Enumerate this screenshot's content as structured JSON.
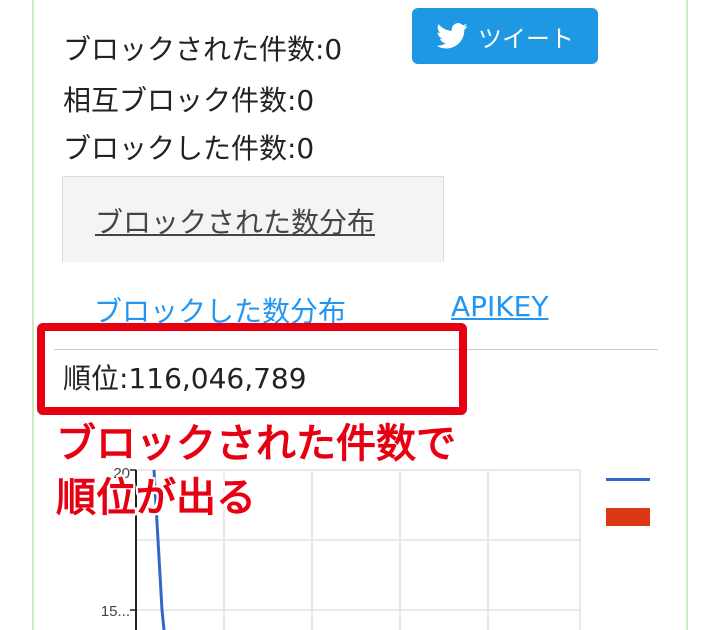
{
  "stats": {
    "blocked_count": "ブロックされた件数:0",
    "mutual_block_count": "相互ブロック件数:0",
    "blocking_count": "ブロックした件数:0"
  },
  "tweet_button": {
    "label": "ツイート",
    "icon": "twitter-bird-icon",
    "color": "#1f98e3"
  },
  "tabs": [
    {
      "label": "ブロックされた数分布",
      "active": true
    },
    {
      "label": "ブロックした数分布",
      "active": false
    },
    {
      "label": "APIKEY",
      "active": false
    }
  ],
  "rank": {
    "text": "順位:116,046,789"
  },
  "annotation": {
    "line1": "ブロックされた件数で",
    "line2": "順位が出る",
    "color": "#e60012"
  },
  "chart_data": {
    "type": "line",
    "y_ticks": [
      "20",
      "15..."
    ],
    "ylim": [
      15,
      20
    ],
    "grid": true,
    "legend_placement": "top-right",
    "series": [
      {
        "color": "#3366cc",
        "values": [
          20,
          15
        ]
      },
      {
        "color": "#dc3912",
        "values": []
      }
    ]
  }
}
